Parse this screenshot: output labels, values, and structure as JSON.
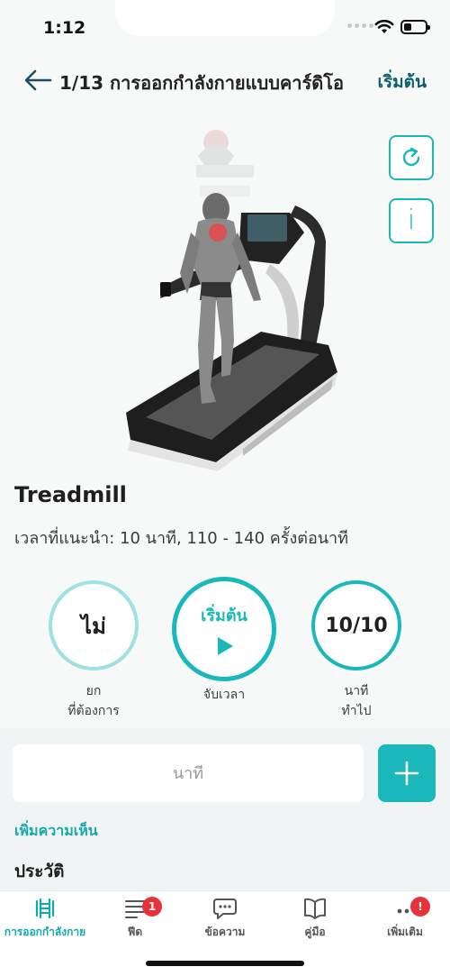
{
  "status_bar": {
    "time": "1:12"
  },
  "header": {
    "title": "1/13 การออกกำลังกายแบบคาร์ดิโอ",
    "start_label": "เริ่มต้น"
  },
  "exercise": {
    "name": "Treadmill",
    "recommendation": "เวลาที่แนะนำ: 10 นาที, 110 - 140 ครั้งต่อนาที"
  },
  "stats": {
    "left": {
      "value": "ไม่",
      "caption_line1": "ยก",
      "caption_line2": "ที่ต้องการ"
    },
    "middle": {
      "label": "เริ่มต้น",
      "caption": "จับเวลา"
    },
    "right": {
      "value": "10/10",
      "caption_line1": "นาที",
      "caption_line2": "ทำไป"
    }
  },
  "input": {
    "placeholder": "นาที"
  },
  "add_comment_label": "เพิ่มความเห็น",
  "history_label": "ประวัติ",
  "tabs": [
    {
      "label": "การออกกำลังกาย",
      "icon": "dumbbell-icon",
      "active": true
    },
    {
      "label": "ฟีด",
      "icon": "feed-icon",
      "badge": "1"
    },
    {
      "label": "ข้อความ",
      "icon": "chat-icon"
    },
    {
      "label": "คู่มือ",
      "icon": "book-icon"
    },
    {
      "label": "เพิ่มเติม",
      "icon": "more-icon",
      "badge": "!"
    }
  ],
  "colors": {
    "accent": "#1bb8bb",
    "accent_light": "#9fe0e2",
    "header_link": "#0e5f70",
    "badge": "#e8323a"
  }
}
